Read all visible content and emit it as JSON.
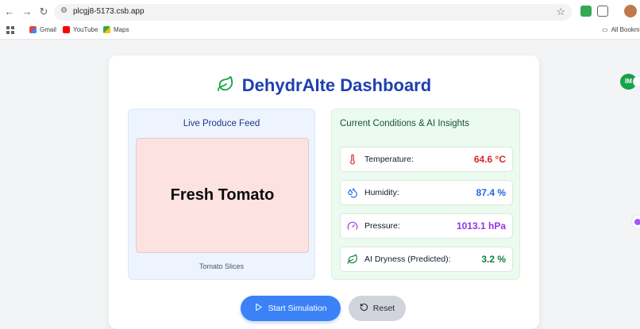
{
  "browser": {
    "url": "plcgj8-5173.csb.app",
    "bookmarks": [
      {
        "label": "Gmail"
      },
      {
        "label": "YouTube"
      },
      {
        "label": "Maps"
      }
    ],
    "all_bookmarks_label": "All Bookmarks"
  },
  "dashboard": {
    "title": "DehydrAIte Dashboard",
    "live_feed": {
      "heading": "Live Produce Feed",
      "item": "Fresh Tomato",
      "caption": "Tomato Slices"
    },
    "conditions": {
      "heading": "Current Conditions & AI Insights",
      "metrics": [
        {
          "label": "Temperature:",
          "value": "64.6 °C",
          "color": "#dc2626",
          "icon": "thermometer-icon"
        },
        {
          "label": "Humidity:",
          "value": "87.4 %",
          "color": "#2563eb",
          "icon": "droplets-icon"
        },
        {
          "label": "Pressure:",
          "value": "1013.1 hPa",
          "color": "#9333ea",
          "icon": "gauge-icon"
        },
        {
          "label": "AI Dryness (Predicted):",
          "value": "3.2 %",
          "color": "#15803d",
          "icon": "leaf-icon"
        }
      ]
    },
    "buttons": {
      "start": "Start Simulation",
      "reset": "Reset"
    }
  },
  "extension_badge": "IM",
  "colors": {
    "title": "#1e40af",
    "start_button": "#3b82f6",
    "leaf": "#16a34a"
  }
}
